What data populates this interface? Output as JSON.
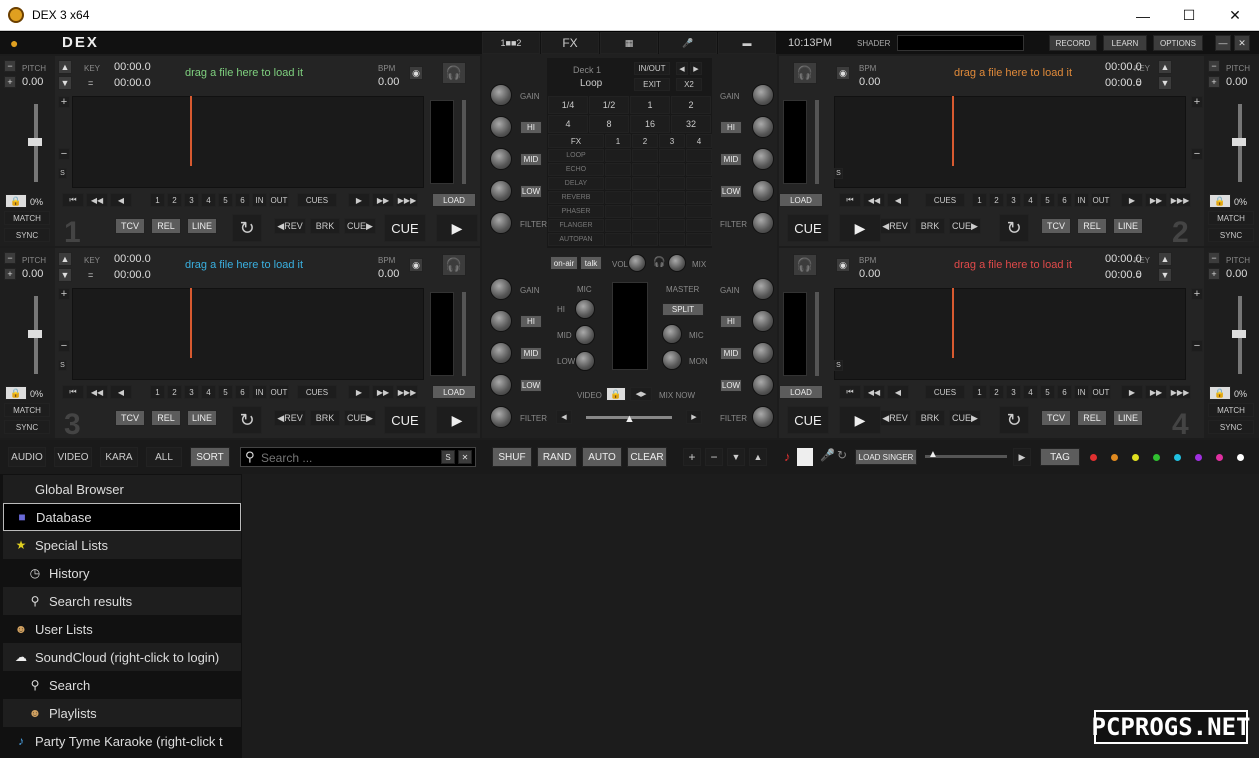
{
  "window": {
    "title": "DEX 3 x64",
    "minimize": "—",
    "maximize": "☐",
    "close": "✕"
  },
  "top": {
    "logo": "DEX",
    "time": "10:13PM",
    "shader": "SHADER",
    "record": "RECORD",
    "learn": "LEARN",
    "options": "OPTIONS",
    "min": "—",
    "close": "✕",
    "tab1": "1■■2",
    "tab_fx": "FX",
    "tab_grid": "▦",
    "tab_mic": "🎤",
    "tab_scr": "▬"
  },
  "deck_common": {
    "pitch": "PITCH",
    "key": "KEY",
    "bpm": "BPM",
    "bpm_val": "0.00",
    "pitch_val": "0.00",
    "time": "00:00.0",
    "key_val": "=",
    "drop": "drag a file here to load it",
    "load": "LOAD",
    "cues": "CUES",
    "in": "IN",
    "out": "OUT",
    "tcv": "TCV",
    "rel": "REL",
    "line": "LINE",
    "rev": "◀REV",
    "brk": "BRK",
    "cue_btn": "CUE▶",
    "cue": "CUE",
    "play": "▶",
    "match": "MATCH",
    "sync": "SYNC",
    "pct": "0%",
    "hot": [
      "1",
      "2",
      "3",
      "4",
      "5",
      "6"
    ],
    "s": "S",
    "minus": "−",
    "plus": "+"
  },
  "decks": [
    "1",
    "2",
    "3",
    "4"
  ],
  "mixer": {
    "gain": "GAIN",
    "hi": "HI",
    "mid": "MID",
    "low": "LOW",
    "filter": "FILTER",
    "deck_label": "Deck 1",
    "loop_label": "Loop",
    "inout": "IN/OUT",
    "exit": "EXIT",
    "x2": "X2",
    "loops": [
      "1/4",
      "1/2",
      "1",
      "2",
      "4",
      "8",
      "16",
      "32"
    ],
    "fx": "FX",
    "fx_nums": [
      "1",
      "2",
      "3",
      "4"
    ],
    "fx_list": [
      "LOOP",
      "ECHO",
      "DELAY",
      "REVERB",
      "PHASER",
      "FLANGER",
      "AUTOPAN"
    ],
    "onair": "on-air",
    "talk": "talk",
    "vol": "VOL",
    "mix": "MIX",
    "mic": "MIC",
    "master": "MASTER",
    "split": "SPLIT",
    "mon": "MON",
    "video": "VIDEO",
    "mixnow": "MIX NOW",
    "mhi": "HI",
    "mmid": "MID",
    "mlow": "LOW",
    "mmic": "MIC"
  },
  "browser_bar": {
    "audio": "AUDIO",
    "video": "VIDEO",
    "kara": "KARA",
    "all": "ALL",
    "sort": "SORT",
    "search_placeholder": "Search ...",
    "s": "S",
    "x": "✕",
    "shuf": "SHUF",
    "rand": "RAND",
    "auto": "AUTO",
    "clear": "CLEAR",
    "plus": "+",
    "minus": "−",
    "down": "▼",
    "up": "▲",
    "load_singer": "LOAD SINGER",
    "tag": "TAG"
  },
  "sidebar": {
    "items": [
      {
        "label": "Global Browser",
        "icon": "none"
      },
      {
        "label": "Database",
        "icon": "floppy-icon"
      },
      {
        "label": "Special Lists",
        "icon": "star-icon"
      },
      {
        "label": "History",
        "icon": "clock-icon"
      },
      {
        "label": "Search results",
        "icon": "magnifier-icon"
      },
      {
        "label": "User Lists",
        "icon": "user-icon"
      },
      {
        "label": "SoundCloud (right-click to login)",
        "icon": "cloud-icon"
      },
      {
        "label": "Search",
        "icon": "magnifier-icon"
      },
      {
        "label": "Playlists",
        "icon": "user-icon"
      },
      {
        "label": "Party Tyme Karaoke (right-click t",
        "icon": "karaoke-icon"
      }
    ]
  },
  "watermark": "PCPROGS.NET",
  "colors": {
    "drop1": "#7fd07f",
    "drop2": "#e08a3a",
    "drop3": "#3ab0e0",
    "drop4": "#e04a4a",
    "tagdots": [
      "#e03030",
      "#e08a20",
      "#e0e020",
      "#30c030",
      "#20c0e0",
      "#a030e0",
      "#e030a0",
      "#ffffff"
    ]
  }
}
